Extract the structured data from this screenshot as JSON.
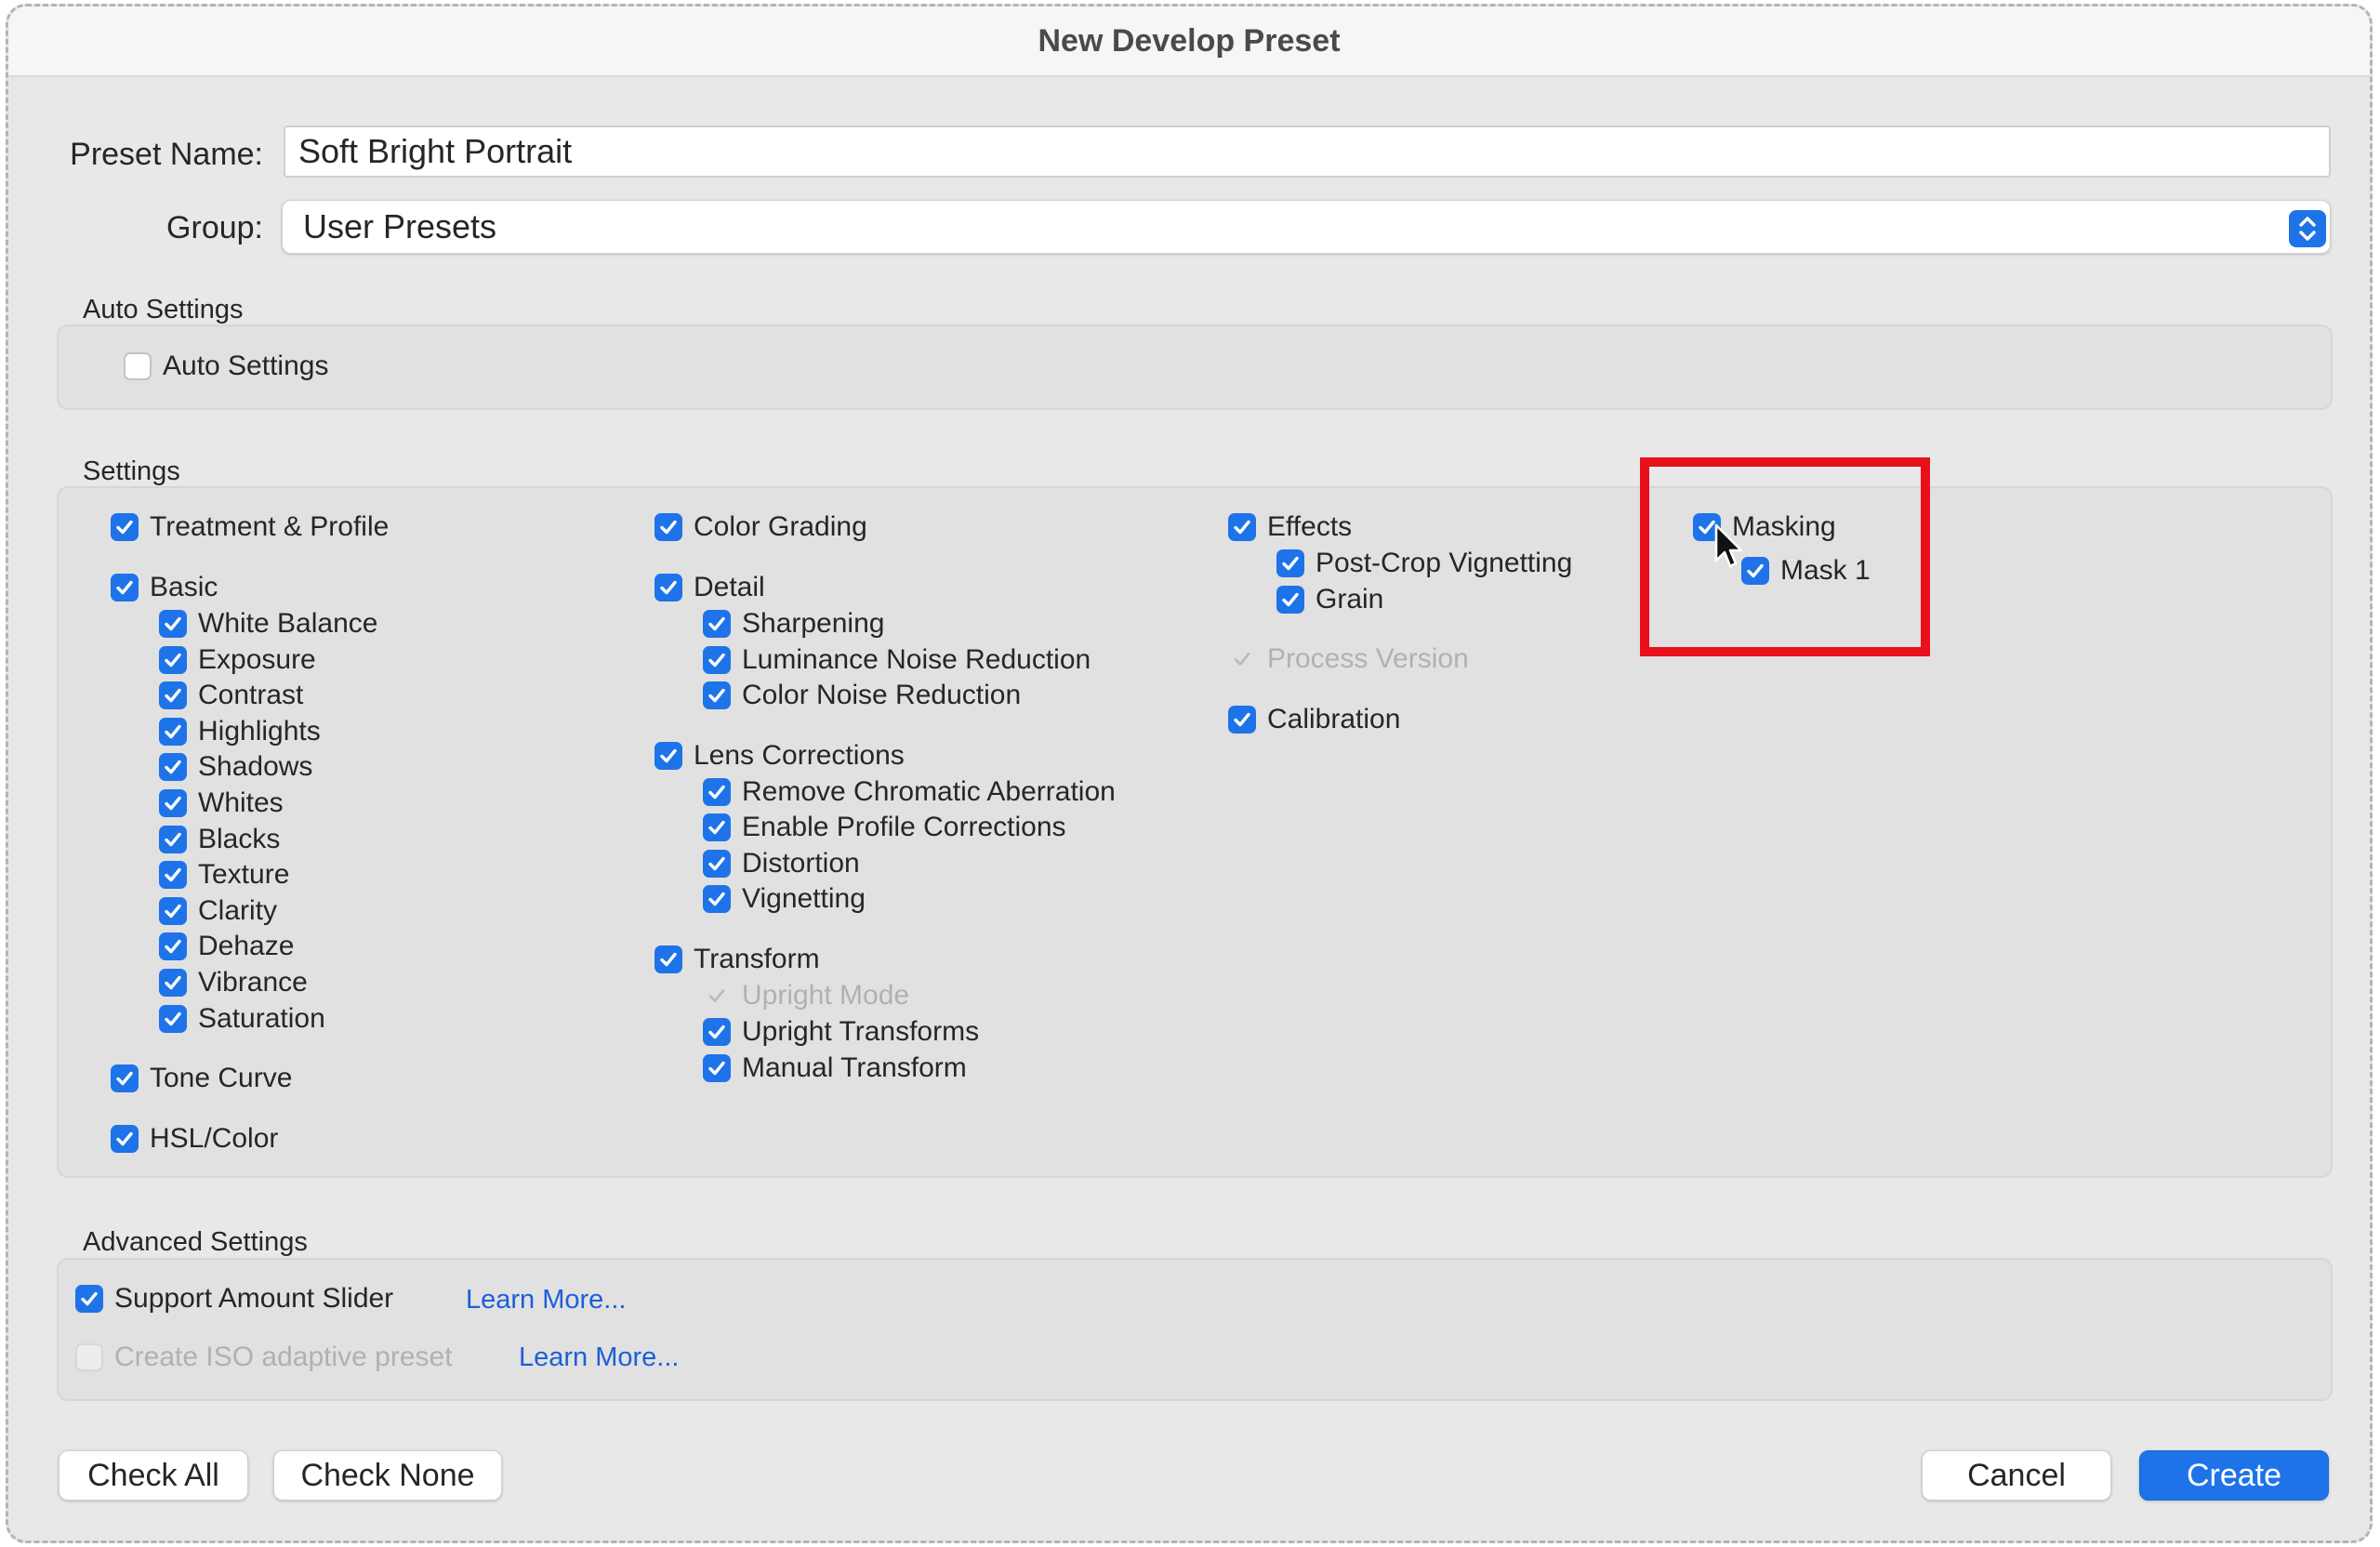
{
  "window": {
    "title": "New Develop Preset"
  },
  "preset_name": {
    "label": "Preset Name:",
    "value": "Soft Bright Portrait"
  },
  "group": {
    "label": "Group:",
    "value": "User Presets"
  },
  "auto_settings": {
    "title": "Auto Settings",
    "checkbox": {
      "label": "Auto Settings",
      "checked": false
    }
  },
  "settings": {
    "title": "Settings",
    "col1": {
      "treatment": "Treatment & Profile",
      "basic": "Basic",
      "basic_items": [
        "White Balance",
        "Exposure",
        "Contrast",
        "Highlights",
        "Shadows",
        "Whites",
        "Blacks",
        "Texture",
        "Clarity",
        "Dehaze",
        "Vibrance",
        "Saturation"
      ],
      "tone_curve": "Tone Curve",
      "hsl": "HSL/Color"
    },
    "col2": {
      "color_grading": "Color Grading",
      "detail": "Detail",
      "detail_items": [
        "Sharpening",
        "Luminance Noise Reduction",
        "Color Noise Reduction"
      ],
      "lens": "Lens Corrections",
      "lens_items": [
        "Remove Chromatic Aberration",
        "Enable Profile Corrections",
        "Distortion",
        "Vignetting"
      ],
      "transform": "Transform",
      "transform_items": [
        "Upright Mode",
        "Upright Transforms",
        "Manual Transform"
      ]
    },
    "col3": {
      "effects": "Effects",
      "effects_items": [
        "Post-Crop Vignetting",
        "Grain"
      ],
      "process_version": "Process Version",
      "calibration": "Calibration"
    },
    "col4": {
      "masking": "Masking",
      "mask1": "Mask 1"
    }
  },
  "advanced": {
    "title": "Advanced Settings",
    "amount_slider": "Support Amount Slider",
    "iso_adaptive": "Create ISO adaptive preset",
    "learn_more": "Learn More..."
  },
  "buttons": {
    "check_all": "Check All",
    "check_none": "Check None",
    "cancel": "Cancel",
    "create": "Create"
  },
  "colors": {
    "accent": "#1e73e8",
    "highlight": "#e8101b",
    "link": "#1c5fd9"
  }
}
